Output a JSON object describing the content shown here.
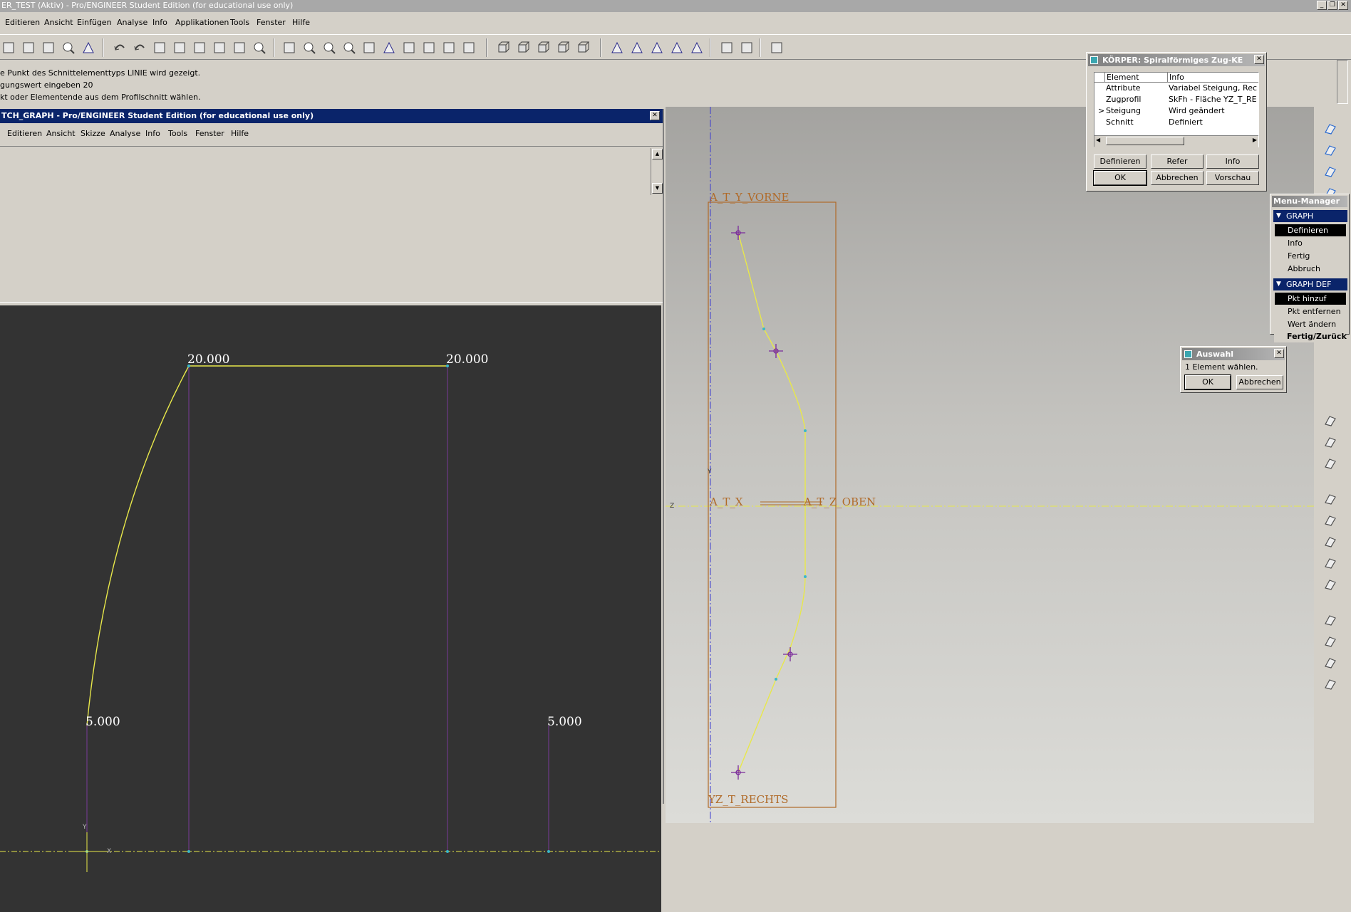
{
  "main_window": {
    "title": "ER_TEST (Aktiv) - Pro/ENGINEER Student Edition (for educational use only)",
    "menu": [
      "Editieren",
      "Ansicht",
      "Einfügen",
      "Analyse",
      "Info",
      "Applikationen",
      "Tools",
      "Fenster",
      "Hilfe"
    ]
  },
  "toolbar": {
    "icons": [
      "open-icon",
      "save-icon",
      "print-icon",
      "send-icon",
      "regenerate-icon",
      "undo-icon",
      "redo-icon",
      "cut-icon",
      "copy-icon",
      "paste-icon",
      "paste-special-icon",
      "model-tree-icon",
      "search-icon",
      "repaint-icon",
      "spin-center-icon",
      "zoom-in-icon",
      "zoom-out-icon",
      "refit-icon",
      "orient-icon",
      "saved-views-icon",
      "layers-icon",
      "layer-tree-icon",
      "model-display-icon",
      "wireframe-icon",
      "hidden-line-icon",
      "no-hidden-icon",
      "shading-icon",
      "datum-planes-icon",
      "datum-axes-icon",
      "datum-points-icon",
      "coord-sys-icon",
      "spin-icon",
      "window-activate-icon",
      "window-close-icon",
      "home-icon",
      "context-help-icon"
    ]
  },
  "messages": [
    "e Punkt des Schnittelementtyps LINIE wird gezeigt.",
    "gungswert eingeben   20",
    "kt oder Elementende aus dem Profilschnitt wählen."
  ],
  "sketch_window": {
    "title": "TCH_GRAPH - Pro/ENGINEER Student Edition (for educational use only)",
    "menu": [
      "Editieren",
      "Ansicht",
      "Skizze",
      "Analyse",
      "Info",
      "Tools",
      "Fenster",
      "Hilfe"
    ],
    "dimensions": [
      "20.000",
      "20.000",
      "5.000",
      "5.000"
    ],
    "axis_labels": {
      "y": "Y",
      "x": "X"
    }
  },
  "graphics": {
    "datum_labels": {
      "front": "A_T_Y_VORNE",
      "x": "A_T_X",
      "top": "A_T_Z_OBEN",
      "right": "YZ_T_RECHTS",
      "y_axis": "Y",
      "z_axis": "Z"
    }
  },
  "feature_dialog": {
    "title": "KÖRPER: Spiralförmiges Zug-KE",
    "columns": [
      "Element",
      "Info"
    ],
    "rows": [
      {
        "element": "Attribute",
        "info": "Variabel Steigung, Rechtsse",
        "current": false
      },
      {
        "element": "Zugprofil",
        "info": "SkFh - Fläche YZ_T_RECH",
        "current": false
      },
      {
        "element": "Steigung",
        "info": "Wird geändert",
        "current": true
      },
      {
        "element": "Schnitt",
        "info": "Definiert",
        "current": false
      }
    ],
    "current_marker": ">",
    "buttons_row1": [
      "Definieren",
      "Refer",
      "Info"
    ],
    "buttons_row2": [
      "OK",
      "Abbrechen",
      "Vorschau"
    ]
  },
  "menu_manager": {
    "title": "Menu-Manager",
    "sections": [
      {
        "header": "GRAPH",
        "items": [
          {
            "label": "Definieren",
            "selected": true
          },
          {
            "label": "Info",
            "selected": false
          },
          {
            "label": "Fertig",
            "selected": false
          },
          {
            "label": "Abbruch",
            "selected": false
          }
        ]
      },
      {
        "header": "GRAPH DEF",
        "items": [
          {
            "label": "Pkt hinzuf",
            "selected": true
          },
          {
            "label": "Pkt entfernen",
            "selected": false
          },
          {
            "label": "Wert ändern",
            "selected": false
          },
          {
            "label": "Fertig/Zurück",
            "selected": false,
            "bold": true
          }
        ]
      }
    ]
  },
  "auswahl_dialog": {
    "title": "Auswahl",
    "message": "1 Element wählen.",
    "ok": "OK",
    "cancel": "Abbrechen"
  },
  "colors": {
    "sketch_bg": "#333333",
    "curve": "#e8e84a",
    "datum": "#b06a28",
    "dim_line": "#7a3b9a",
    "titlebar_active": "#0a246a"
  }
}
